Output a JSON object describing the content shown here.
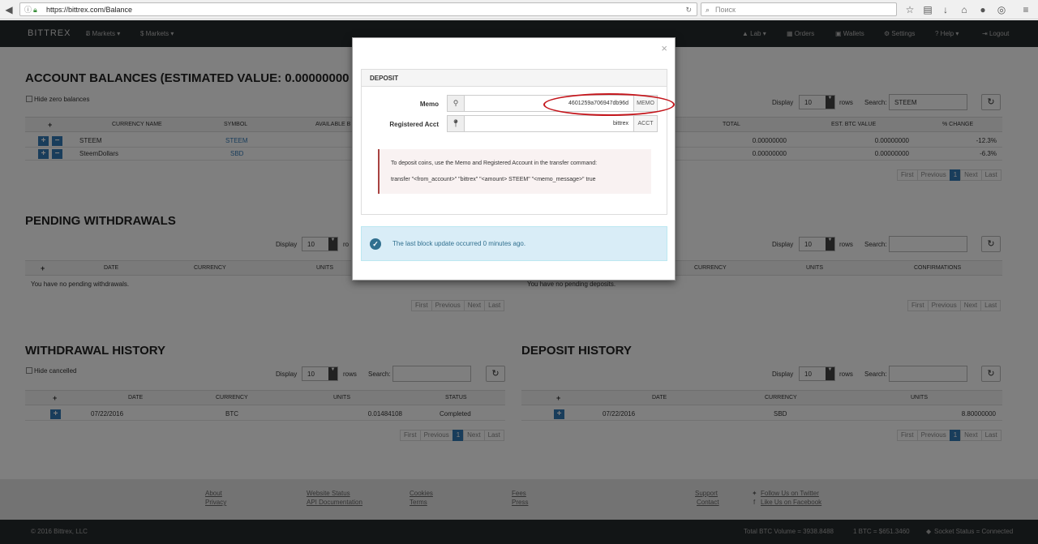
{
  "browser": {
    "url": "https://bittrex.com/Balance",
    "search_placeholder": "Поиск"
  },
  "nav": {
    "brand": "BITTREX",
    "left": [
      "Ƀ Markets ▾",
      "$ Markets ▾"
    ],
    "right": [
      "Lab ▾",
      "Orders",
      "Wallets",
      "Settings",
      "Help ▾",
      "Logout"
    ]
  },
  "balances": {
    "title": "ACCOUNT BALANCES (ESTIMATED VALUE: 0.00000000 BTC",
    "hide_zero": "Hide zero balances",
    "display_label": "Display",
    "rows_value": "10",
    "rows_label": "rows",
    "search_label": "Search:",
    "search_value": "STEEM",
    "headers": [
      "+",
      "CURRENCY NAME",
      "SYMBOL",
      "AVAILABLE B",
      "TOTAL",
      "EST. BTC VALUE",
      "% CHANGE"
    ],
    "rows": [
      {
        "name": "STEEM",
        "symbol": "STEEM",
        "total": "0.00000000",
        "btc": "0.00000000",
        "change": "-12.3%"
      },
      {
        "name": "SteemDollars",
        "symbol": "SBD",
        "total": "0.00000000",
        "btc": "0.00000000",
        "change": "-6.3%"
      }
    ],
    "pager": [
      "First",
      "Previous",
      "1",
      "Next",
      "Last"
    ]
  },
  "pending_withdrawals": {
    "title": "PENDING WITHDRAWALS",
    "display_label": "Display",
    "rows_value": "10",
    "rows_label": "ro",
    "headers": [
      "+",
      "DATE",
      "CURRENCY",
      "UNITS"
    ],
    "empty": "You have no pending withdrawals.",
    "pager": [
      "First",
      "Previous",
      "Next",
      "Last"
    ]
  },
  "pending_deposits": {
    "display_label": "Display",
    "rows_value": "10",
    "rows_label": "rows",
    "search_label": "Search:",
    "headers": [
      "CURRENCY",
      "UNITS",
      "CONFIRMATIONS"
    ],
    "empty": "You have no pending deposits.",
    "pager": [
      "First",
      "Previous",
      "Next",
      "Last"
    ]
  },
  "withdrawal_history": {
    "title": "WITHDRAWAL HISTORY",
    "hide_cancelled": "Hide cancelled",
    "display_label": "Display",
    "rows_value": "10",
    "rows_label": "rows",
    "search_label": "Search:",
    "headers": [
      "+",
      "DATE",
      "CURRENCY",
      "UNITS",
      "STATUS"
    ],
    "rows": [
      {
        "date": "07/22/2016",
        "currency": "BTC",
        "units": "0.01484108",
        "status": "Completed"
      }
    ],
    "pager": [
      "First",
      "Previous",
      "1",
      "Next",
      "Last"
    ]
  },
  "deposit_history": {
    "title": "DEPOSIT HISTORY",
    "display_label": "Display",
    "rows_value": "10",
    "rows_label": "rows",
    "search_label": "Search:",
    "headers": [
      "+",
      "DATE",
      "CURRENCY",
      "UNITS"
    ],
    "rows": [
      {
        "date": "07/22/2016",
        "currency": "SBD",
        "units": "8.80000000"
      }
    ],
    "pager": [
      "First",
      "Previous",
      "1",
      "Next",
      "Last"
    ]
  },
  "footer": {
    "col1": [
      "About",
      "Privacy"
    ],
    "col2": [
      "Website Status",
      "API Documentation"
    ],
    "col3": [
      "Cookies",
      "Terms"
    ],
    "col4": [
      "Fees",
      "Press"
    ],
    "col5": [
      "Support",
      "Contact"
    ],
    "col6": [
      "Follow Us on Twitter",
      "Like Us on Facebook"
    ]
  },
  "bottom": {
    "copyright": "© 2016 Bittrex, LLC",
    "volume": "Total BTC Volume = 3938.8488",
    "price": "1 BTC = $651.3460",
    "socket": "Socket Status = Connected"
  },
  "modal": {
    "close": "×",
    "panel_title": "DEPOSIT",
    "memo_label": "Memo",
    "memo_value": "4601259a706947db96d",
    "memo_button": "MEMO",
    "acct_label": "Registered Acct",
    "acct_value": "bittrex",
    "acct_button": "ACCT",
    "instruction1": "To deposit coins, use the Memo and Registered Account in the transfer command:",
    "instruction2": "transfer \"<from_account>\" \"bittrex\" \"<amount> STEEM\" \"<memo_message>\" true",
    "alert": "The last block update occurred 0 minutes ago."
  },
  "colors": {
    "accent": "#337ab7",
    "nav_bg": "#252a2d",
    "annotation": "#c4161c"
  }
}
